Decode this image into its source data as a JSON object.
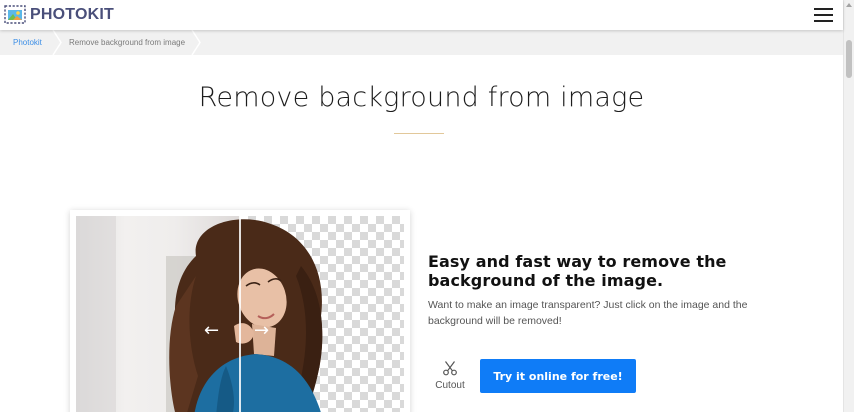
{
  "brand": {
    "name": "PHOTOKIT",
    "logo_icon": "photokit-logo-icon",
    "color": "#4a4f7a"
  },
  "header": {
    "menu_icon": "hamburger-menu-icon"
  },
  "breadcrumb": {
    "items": [
      "Photokit",
      "Remove background from image"
    ]
  },
  "main": {
    "title": "Remove background from image",
    "feature": {
      "heading": "Easy and fast way to remove the background of the image.",
      "description": "Want to make an image transparent? Just click on the image and the background will be removed!"
    },
    "tool": {
      "label": "Cutout",
      "icon": "scissors-icon"
    },
    "cta_label": "Try it online for free!",
    "accent_color": "#0f7cf7",
    "demo": {
      "left_arrow_icon": "arrow-left-icon",
      "right_arrow_icon": "arrow-right-icon",
      "transparent_pattern": "checkerboard"
    }
  }
}
